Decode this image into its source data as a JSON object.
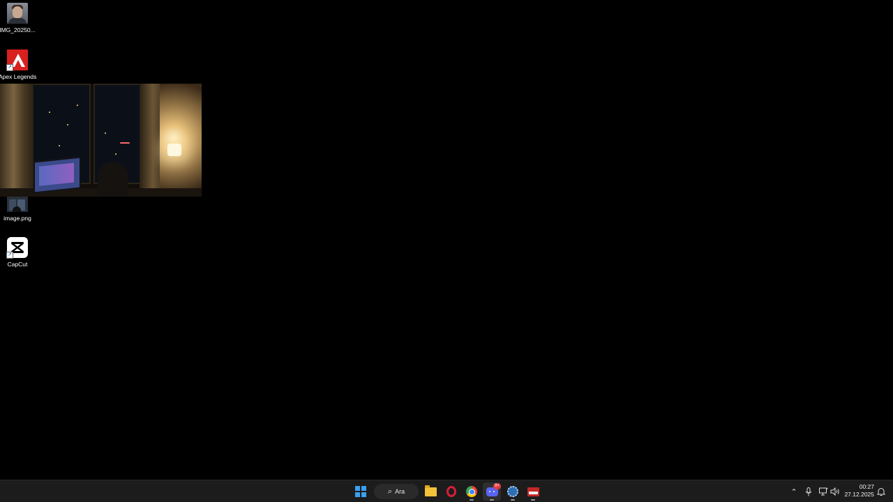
{
  "desktop": {
    "icons": [
      {
        "label": "IMG_20250...",
        "icon": "avatar-image-icon"
      },
      {
        "label": "Apex Legends",
        "icon": "apex-legends-icon"
      },
      {
        "label": "image.png",
        "icon": "image-file-icon"
      },
      {
        "label": "CapCut",
        "icon": "capcut-icon"
      }
    ],
    "webcam_preview": {
      "icon": "webcam-feed"
    }
  },
  "taskbar": {
    "search_label": "Ara",
    "discord_badge": "9+",
    "apps": [
      "start-icon",
      "file-explorer-icon",
      "opera-gx-icon",
      "chrome-icon",
      "discord-icon",
      "settings-app-icon",
      "card-app-icon"
    ],
    "tray": [
      "chevron-up-icon",
      "microphone-icon",
      "network-icon",
      "volume-icon",
      "notification-icon"
    ],
    "time": "00:27",
    "date": "27.12.2025"
  },
  "colors": {
    "taskbar_bg": "#1c1c1c",
    "start_blue": "#3aa0f0",
    "apex_red": "#d8201f",
    "discord": "#5865f2"
  }
}
